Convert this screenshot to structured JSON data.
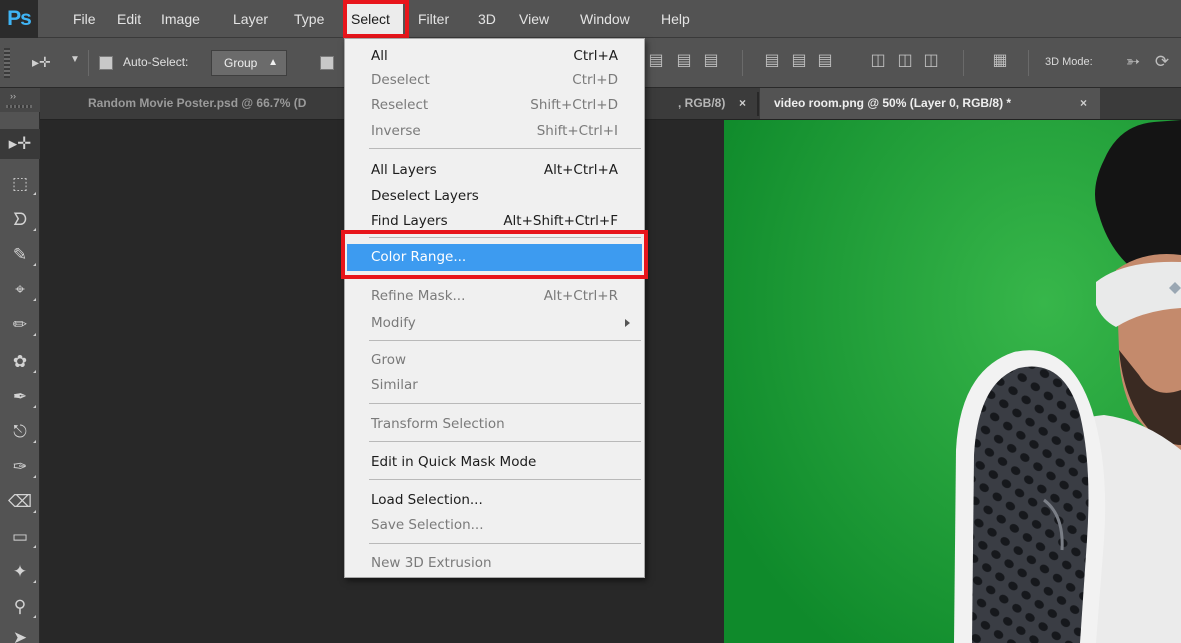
{
  "app": {
    "logo": "Ps",
    "menu": [
      "File",
      "Edit",
      "Image",
      "Layer",
      "Type",
      "Select",
      "Filter",
      "3D",
      "View",
      "Window",
      "Help"
    ],
    "active_menu": "Select"
  },
  "options_bar": {
    "auto_select_label": "Auto-Select:",
    "auto_select_value": "Group",
    "mode_label": "3D Mode:"
  },
  "tabs": [
    {
      "label": "Random Movie Poster.psd @ 66.7% (D"
    },
    {
      "label": ", RGB/8)",
      "close": "×"
    },
    {
      "label": "video room.png @ 50% (Layer 0, RGB/8) *",
      "close": "×"
    }
  ],
  "toolbar": {
    "collapse_label": "››",
    "tools": [
      "move-tool",
      "marquee-tool",
      "lasso-tool",
      "quick-selection-tool",
      "crop-tool",
      "eyedropper-tool",
      "spot-healing-tool",
      "brush-tool",
      "clone-stamp-tool",
      "history-brush-tool",
      "eraser-tool",
      "gradient-tool",
      "blur-tool",
      "dodge-tool",
      "pen-tool"
    ]
  },
  "select_menu": {
    "items": [
      {
        "label": "All",
        "shortcut": "Ctrl+A",
        "disabled": false
      },
      {
        "label": "Deselect",
        "shortcut": "Ctrl+D",
        "disabled": true
      },
      {
        "label": "Reselect",
        "shortcut": "Shift+Ctrl+D",
        "disabled": true
      },
      {
        "label": "Inverse",
        "shortcut": "Shift+Ctrl+I",
        "disabled": true
      },
      {
        "label": "All Layers",
        "shortcut": "Alt+Ctrl+A",
        "disabled": false
      },
      {
        "label": "Deselect Layers",
        "shortcut": "",
        "disabled": false
      },
      {
        "label": "Find Layers",
        "shortcut": "Alt+Shift+Ctrl+F",
        "disabled": false
      },
      {
        "label": "Color Range...",
        "shortcut": "",
        "disabled": false,
        "highlighted": true
      },
      {
        "label": "Refine Mask...",
        "shortcut": "Alt+Ctrl+R",
        "disabled": true
      },
      {
        "label": "Modify",
        "shortcut": "",
        "disabled": true,
        "submenu": true
      },
      {
        "label": "Grow",
        "shortcut": "",
        "disabled": true
      },
      {
        "label": "Similar",
        "shortcut": "",
        "disabled": true
      },
      {
        "label": "Transform Selection",
        "shortcut": "",
        "disabled": true
      },
      {
        "label": "Edit in Quick Mask Mode",
        "shortcut": "",
        "disabled": false
      },
      {
        "label": "Load Selection...",
        "shortcut": "",
        "disabled": false
      },
      {
        "label": "Save Selection...",
        "shortcut": "",
        "disabled": true
      },
      {
        "label": "New 3D Extrusion",
        "shortcut": "",
        "disabled": true
      }
    ]
  },
  "colors": {
    "menu_highlight": "#3d9bf0",
    "annotation_box": "#e8151b",
    "photo_backdrop": "#1fa032"
  }
}
